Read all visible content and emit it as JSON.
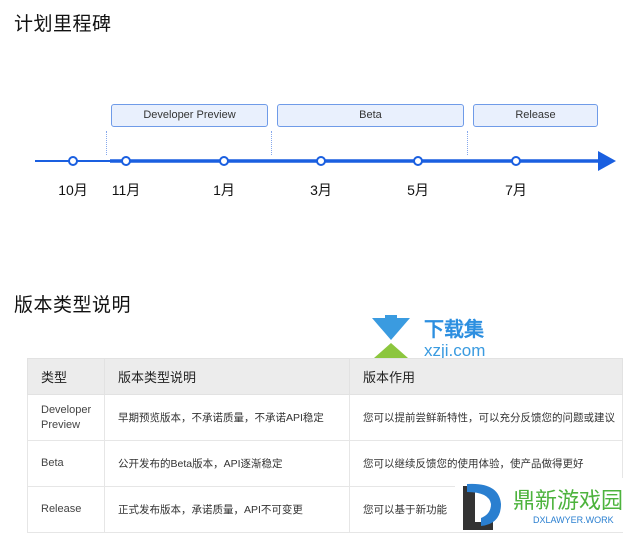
{
  "sections": {
    "timeline_title": "计划里程碑",
    "table_title": "版本类型说明"
  },
  "timeline": {
    "phases": [
      {
        "label": "Developer Preview"
      },
      {
        "label": "Beta"
      },
      {
        "label": "Release"
      }
    ],
    "months": [
      "10月",
      "11月",
      "1月",
      "3月",
      "5月",
      "7月"
    ],
    "color": "#1a5fe0"
  },
  "table": {
    "headers": [
      "类型",
      "版本类型说明",
      "版本作用"
    ],
    "rows": [
      [
        "Developer Preview",
        "早期预览版本，不承诺质量，不承诺API稳定",
        "您可以提前尝鲜新特性，可以充分反馈您的问题或建议"
      ],
      [
        "Beta",
        "公开发布的Beta版本，API逐渐稳定",
        "您可以继续反馈您的使用体验，使产品做得更好"
      ],
      [
        "Release",
        "正式发布版本，承诺质量，API不可变更",
        "您可以基于新功能"
      ]
    ]
  },
  "watermarks": {
    "top_cn": "下载集",
    "top_en": "xzji.com",
    "bottom_cn": "鼎新游戏园",
    "bottom_en": "DXLAWYER.WORK"
  }
}
